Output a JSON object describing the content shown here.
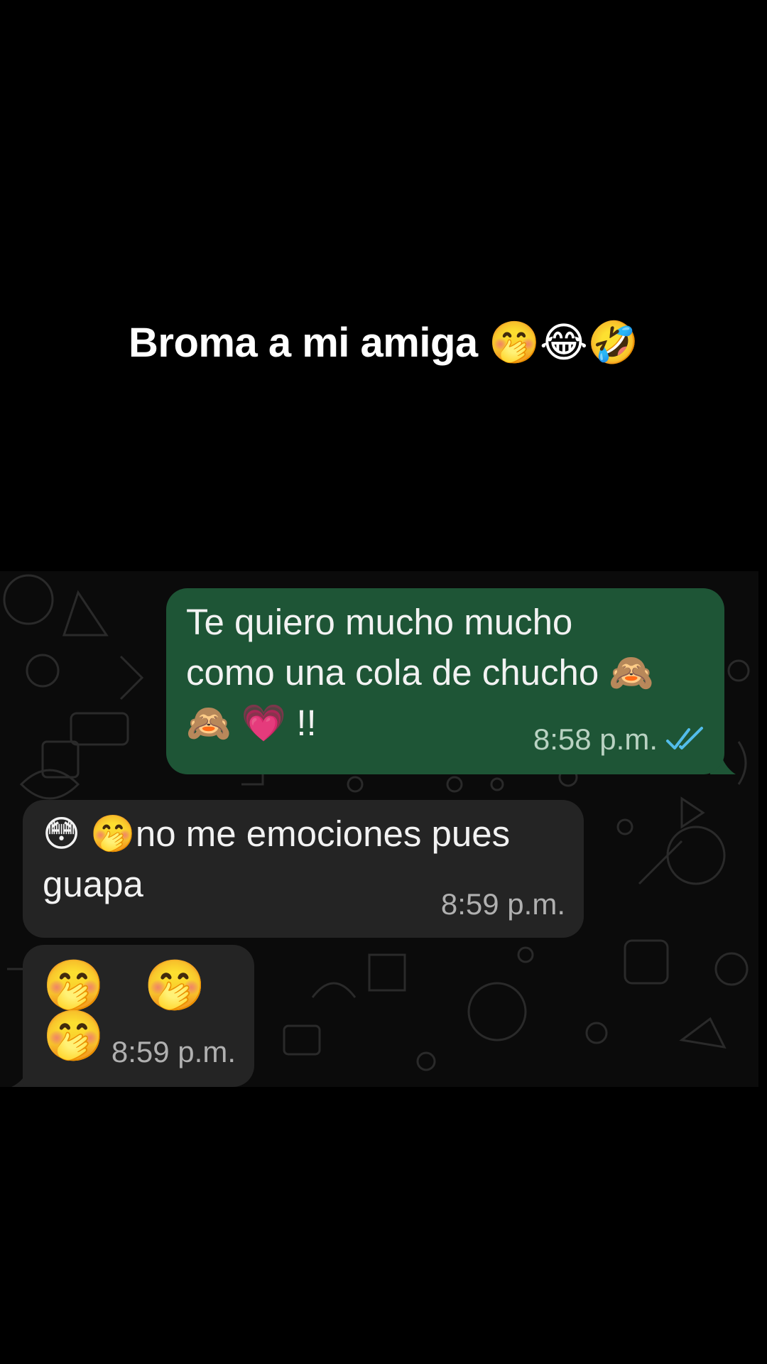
{
  "caption": {
    "text": "Broma a mi amiga 🤭😂🤣"
  },
  "messages": [
    {
      "direction": "outgoing",
      "line1": "Te quiero mucho mucho",
      "line2": "como una cola de chucho 🙈",
      "line3": "🙈 💗 !!",
      "time": "8:58 p.m.",
      "status": "read",
      "status_color": "#53bdeb"
    },
    {
      "direction": "incoming",
      "line1": "😳 🤭no me emociones pues",
      "line2": "guapa",
      "time": "8:59 p.m."
    },
    {
      "direction": "incoming",
      "line1": "🤭 🤭 🤭",
      "time": "8:59 p.m."
    }
  ],
  "colors": {
    "background": "#000000",
    "outgoing_bubble": "#1e5536",
    "incoming_bubble": "#242424",
    "text": "#f2f2f2",
    "read_ticks": "#53bdeb"
  }
}
